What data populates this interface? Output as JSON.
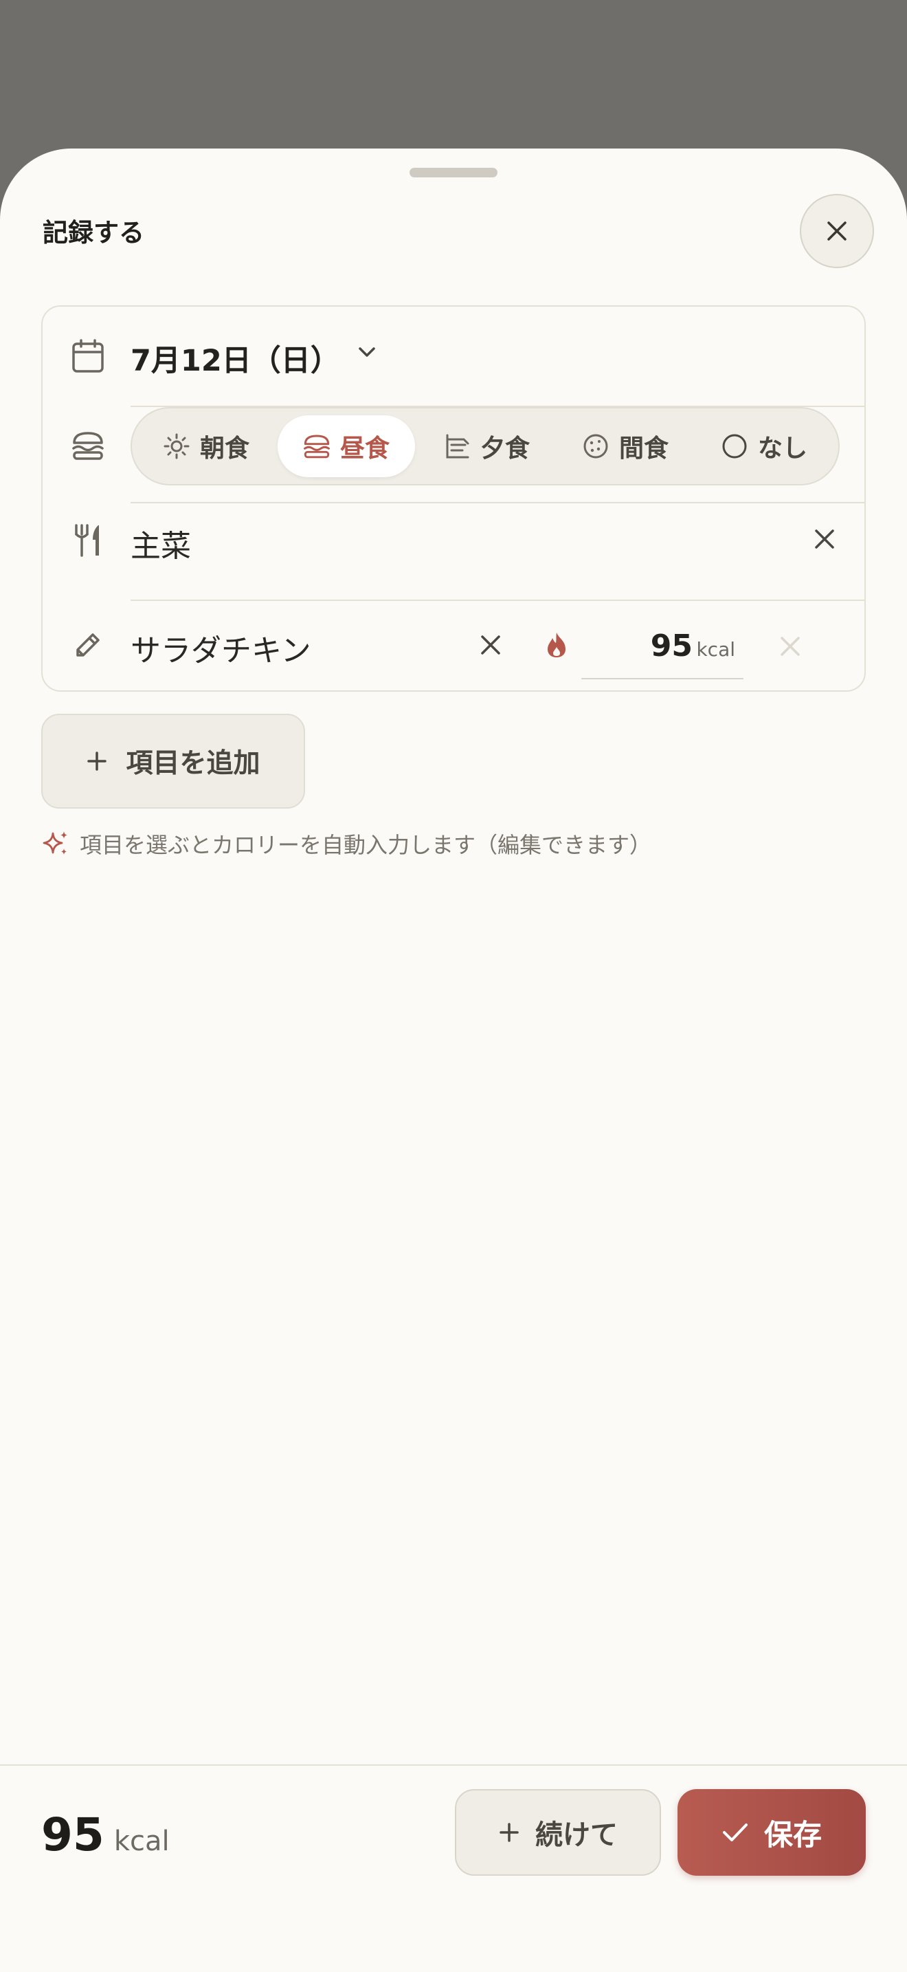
{
  "sheet": {
    "title": "記録する"
  },
  "entry": {
    "date": "7月12日（日）",
    "meal_tabs": [
      {
        "label": "朝食",
        "icon": "sun-icon"
      },
      {
        "label": "昼食",
        "icon": "burger-icon",
        "selected": true
      },
      {
        "label": "夕食",
        "icon": "sunset-icon"
      },
      {
        "label": "間食",
        "icon": "cookie-icon"
      },
      {
        "label": "なし",
        "icon": "circle-icon"
      }
    ],
    "category": "主菜",
    "item_name": "サラダチキン",
    "item_kcal": "95",
    "kcal_unit": "kcal"
  },
  "add_item_label": "項目を追加",
  "hint": "項目を選ぶとカロリーを自動入力します（編集できます）",
  "footer": {
    "total_value": "95",
    "total_unit": "kcal",
    "continue_label": "続けて",
    "save_label": "保存"
  },
  "colors": {
    "accent": "#b5584b",
    "backdrop": "#6f6e6b",
    "sheet": "#fbfaf7",
    "save_button": "#b05650"
  }
}
